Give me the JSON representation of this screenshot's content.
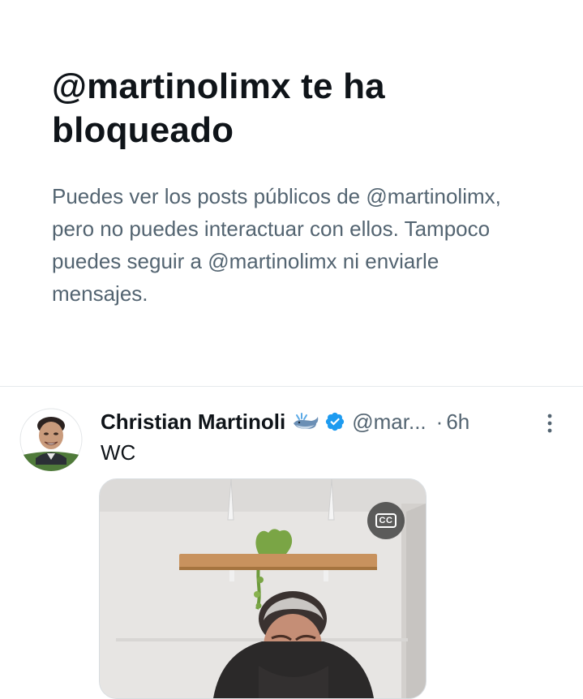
{
  "blocked": {
    "title": "@martinolimx te ha bloqueado",
    "message": "Puedes ver los posts públicos de @martinolimx, pero no puedes interactuar con ellos. Tampoco puedes seguir a @martinolimx ni enviarle mensajes."
  },
  "post": {
    "author_name": "Christian Martinoli",
    "handle": "@mar...",
    "separator": "·",
    "time": "6h",
    "text": "WC",
    "icons": {
      "avatar": "avatar",
      "badge_emoji": "whale-icon",
      "verified": "verified-badge-icon",
      "more": "more-options-icon",
      "captions": "closed-captions-icon"
    },
    "media": {
      "captions_label": "CC"
    }
  },
  "colors": {
    "text_primary": "#0f1419",
    "text_secondary": "#536471",
    "verified_blue": "#1d9bf0",
    "divider": "#e6e9ec"
  }
}
